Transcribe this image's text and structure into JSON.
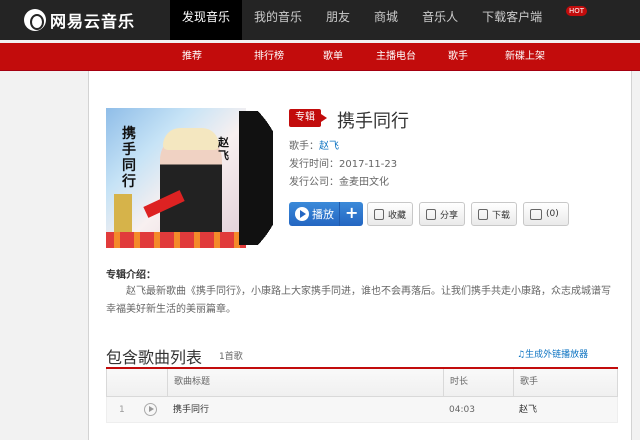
{
  "brand": {
    "name": "网易云音乐"
  },
  "nav": {
    "items": [
      "发现音乐",
      "我的音乐",
      "朋友",
      "商城",
      "音乐人",
      "下载客户端"
    ],
    "hot_badge": "HOT"
  },
  "subnav": {
    "items": [
      "推荐",
      "排行榜",
      "歌单",
      "主播电台",
      "歌手",
      "新碟上架"
    ]
  },
  "album": {
    "tag": "专辑",
    "title": "携手同行",
    "artist_label": "歌手：",
    "artist": "赵飞",
    "release_label": "发行时间：",
    "release_date": "2017-11-23",
    "company_label": "发行公司：",
    "company": "金麦田文化",
    "cover_title": "携手同行",
    "cover_artist": "赵飞"
  },
  "actions": {
    "play": "播放",
    "add": "+",
    "collect": "收藏",
    "share": "分享",
    "download": "下载",
    "comment": "(0)"
  },
  "intro": {
    "heading": "专辑介绍：",
    "text": "赵飞最新歌曲《携手同行》，小康路上大家携手同进，谁也不会再落后。让我们携手共走小康路，众志成城谱写幸福美好新生活的美丽篇章。"
  },
  "song_list": {
    "heading": "包含歌曲列表",
    "count": "1首歌",
    "external_player": "生成外链播放器",
    "columns": [
      "歌曲标题",
      "时长",
      "歌手"
    ],
    "rows": [
      {
        "index": "1",
        "title": "携手同行",
        "duration": "04:03",
        "artist": "赵飞"
      }
    ]
  },
  "colors": {
    "brand_red": "#c20c0c",
    "topbar": "#242424",
    "link_blue": "#0c73c2",
    "play_blue": "#2466c2"
  }
}
